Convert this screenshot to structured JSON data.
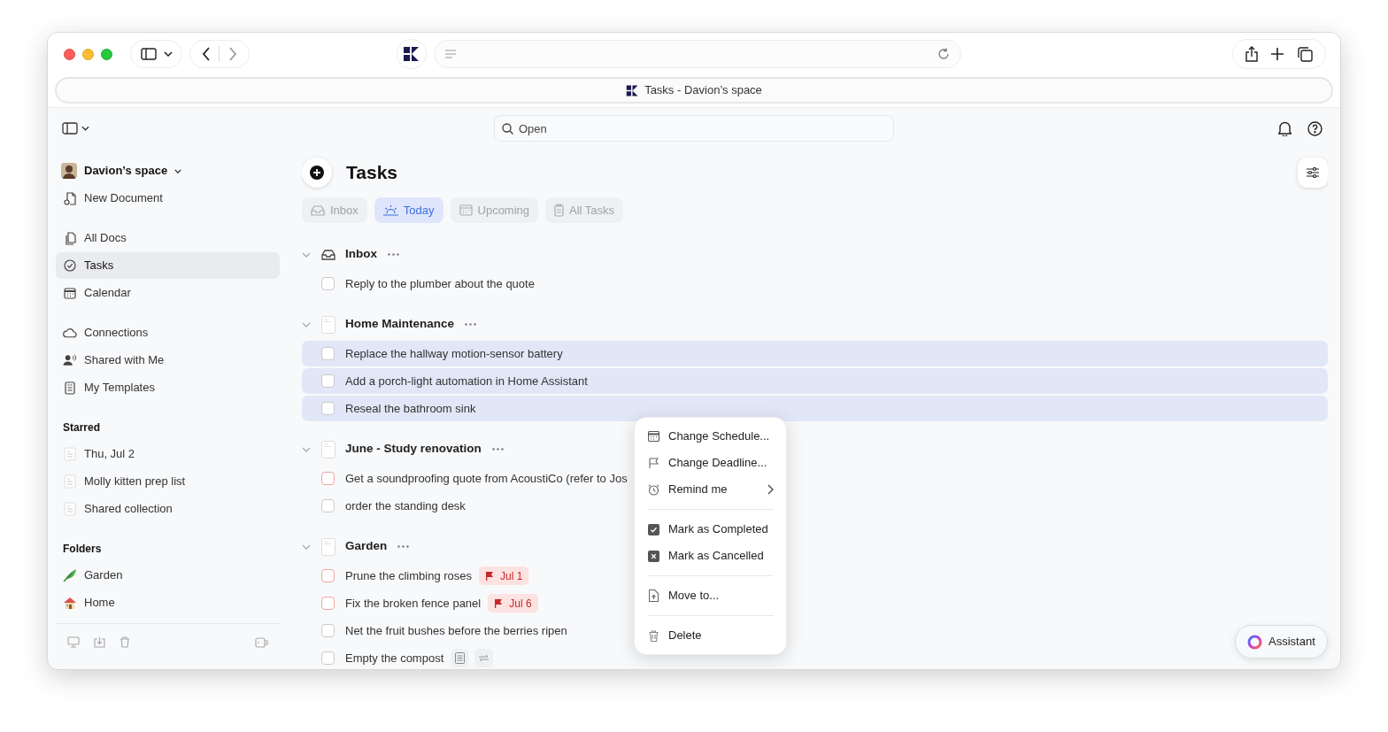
{
  "browser": {
    "tab_title": "Tasks - Davion’s space"
  },
  "search": {
    "placeholder": "Open"
  },
  "sidebar": {
    "workspace": "Davion’s space",
    "groups": [
      {
        "items": [
          {
            "label": "New Document",
            "selected": false
          }
        ]
      },
      {
        "items": [
          {
            "label": "All Docs",
            "selected": false
          },
          {
            "label": "Tasks",
            "selected": true
          },
          {
            "label": "Calendar",
            "selected": false
          }
        ]
      },
      {
        "items": [
          {
            "label": "Connections",
            "selected": false
          },
          {
            "label": "Shared with Me",
            "selected": false
          },
          {
            "label": "My Templates",
            "selected": false
          }
        ]
      },
      {
        "heading": "Starred",
        "items": [
          {
            "label": "Thu, Jul 2",
            "selected": false
          },
          {
            "label": "Molly kitten prep list",
            "selected": false
          },
          {
            "label": "Shared collection",
            "selected": false
          }
        ]
      },
      {
        "heading": "Folders",
        "items": [
          {
            "label": "Garden",
            "selected": false
          },
          {
            "label": "Home",
            "selected": false
          }
        ]
      }
    ]
  },
  "page": {
    "title": "Tasks",
    "filters": [
      {
        "label": "Inbox",
        "selected": false
      },
      {
        "label": "Today",
        "selected": true
      },
      {
        "label": "Upcoming",
        "selected": false
      },
      {
        "label": "All Tasks",
        "selected": false
      }
    ],
    "sections": [
      {
        "title": "Inbox",
        "kind": "inbox",
        "tasks": [
          {
            "label": "Reply to the plumber about the quote",
            "selected": false,
            "color": "#c9c9cc"
          }
        ]
      },
      {
        "title": "Home Maintenance",
        "kind": "page",
        "tasks": [
          {
            "label": "Replace the hallway motion-sensor battery",
            "selected": true,
            "color": "#c9c9cc"
          },
          {
            "label": "Add a porch-light automation in Home Assistant",
            "selected": true,
            "color": "#c9c9cc"
          },
          {
            "label": "Reseal the bathroom sink",
            "selected": true,
            "color": "#c9c9cc"
          }
        ]
      },
      {
        "title": "June - Study renovation",
        "kind": "page",
        "tasks": [
          {
            "label": "Get a soundproofing quote from AcoustiCo (refer to Jos",
            "selected": false,
            "color": "#f0a3a0"
          },
          {
            "label": "order the standing desk",
            "selected": false,
            "color": "#c9c9cc"
          }
        ]
      },
      {
        "title": "Garden",
        "kind": "page",
        "tasks": [
          {
            "label": "Prune the climbing roses",
            "selected": false,
            "color": "#f0a3a0",
            "deadline": "Jul 1"
          },
          {
            "label": "Fix the broken fence panel",
            "selected": false,
            "color": "#f0a3a0",
            "deadline": "Jul 6"
          },
          {
            "label": "Net the fruit bushes before the berries ripen",
            "selected": false,
            "color": "#c9c9cc"
          },
          {
            "label": "Empty the compost",
            "selected": false,
            "color": "#c9c9cc",
            "has_note": true,
            "repeats": true
          }
        ]
      }
    ]
  },
  "context_menu": {
    "sections": [
      [
        {
          "label": "Change Schedule...",
          "submenu": false
        },
        {
          "label": "Change Deadline...",
          "submenu": false
        },
        {
          "label": "Remind me",
          "submenu": true
        }
      ],
      [
        {
          "label": "Mark as Completed",
          "submenu": false
        },
        {
          "label": "Mark as Cancelled",
          "submenu": false
        }
      ],
      [
        {
          "label": "Move to...",
          "submenu": false
        }
      ],
      [
        {
          "label": "Delete",
          "submenu": false
        }
      ]
    ]
  },
  "assistant": {
    "label": "Assistant"
  }
}
